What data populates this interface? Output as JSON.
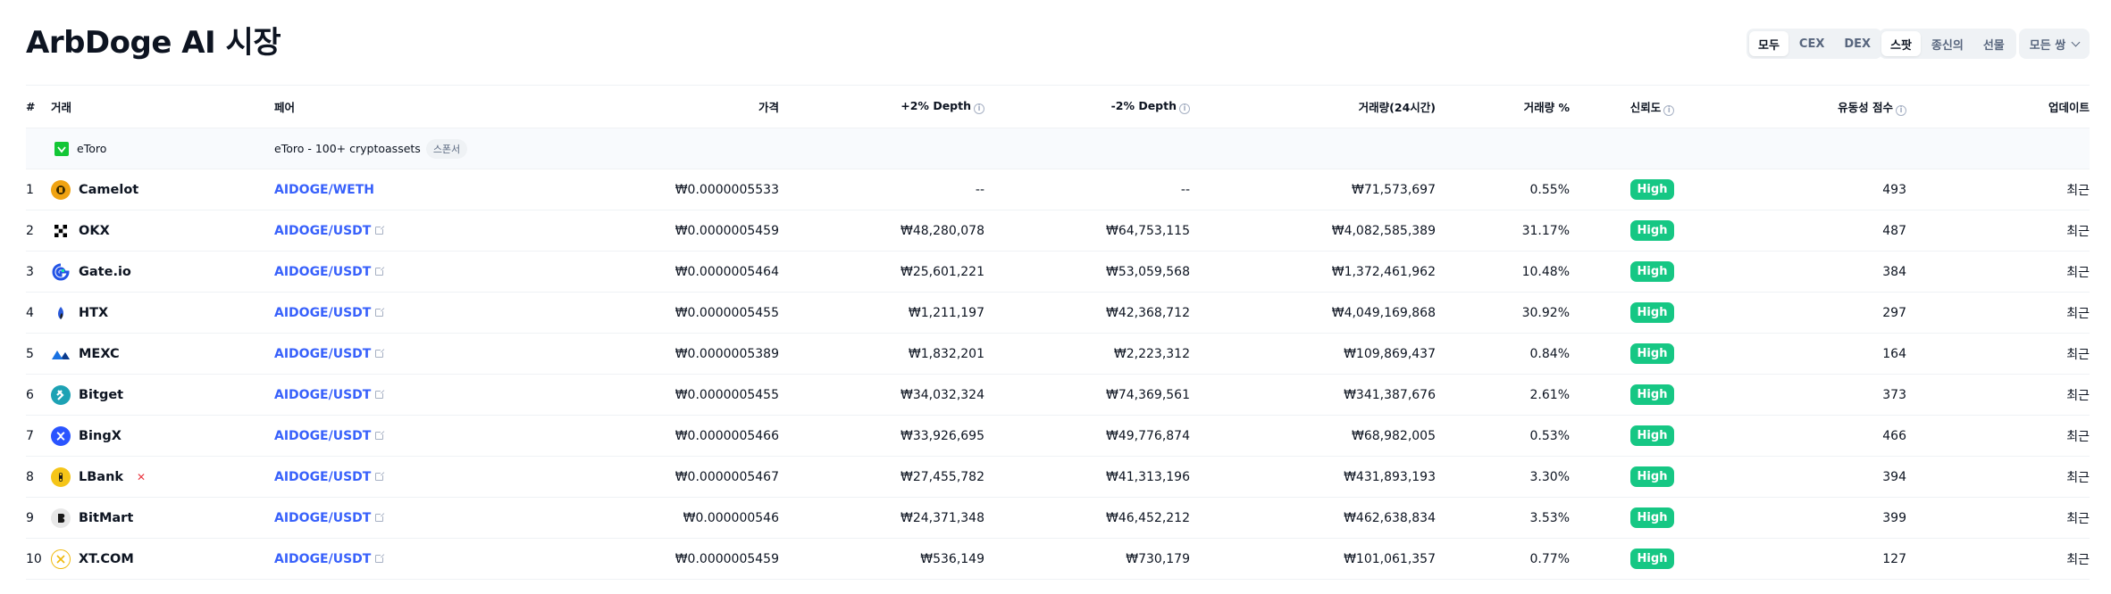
{
  "header": {
    "title": "ArbDoge AI 시장"
  },
  "filters": {
    "exchange_type": [
      "모두",
      "CEX",
      "DEX"
    ],
    "market_type": [
      "스팟",
      "종신의",
      "선물"
    ],
    "pairs_dropdown": "모든 쌍"
  },
  "columns": {
    "rank": "#",
    "exchange": "거래",
    "pair": "페어",
    "price": "가격",
    "depth_plus": "+2% Depth",
    "depth_minus": "-2% Depth",
    "volume": "거래량(24시간)",
    "volume_pct": "거래량 %",
    "confidence": "신뢰도",
    "liquidity": "유동성 점수",
    "updated": "업데이트"
  },
  "sponsor": {
    "name": "eToro",
    "text": "eToro - 100+ cryptoassets",
    "badge": "스폰서"
  },
  "rows": [
    {
      "rank": "1",
      "exchange": "Camelot",
      "pair": "AIDOGE/WETH",
      "price": "₩0.0000005533",
      "depth_plus": "--",
      "depth_minus": "--",
      "volume": "₩71,573,697",
      "volume_pct": "0.55%",
      "confidence": "High",
      "liquidity": "493",
      "updated": "최근"
    },
    {
      "rank": "2",
      "exchange": "OKX",
      "pair": "AIDOGE/USDT",
      "price": "₩0.0000005459",
      "depth_plus": "₩48,280,078",
      "depth_minus": "₩64,753,115",
      "volume": "₩4,082,585,389",
      "volume_pct": "31.17%",
      "confidence": "High",
      "liquidity": "487",
      "updated": "최근"
    },
    {
      "rank": "3",
      "exchange": "Gate.io",
      "pair": "AIDOGE/USDT",
      "price": "₩0.0000005464",
      "depth_plus": "₩25,601,221",
      "depth_minus": "₩53,059,568",
      "volume": "₩1,372,461,962",
      "volume_pct": "10.48%",
      "confidence": "High",
      "liquidity": "384",
      "updated": "최근"
    },
    {
      "rank": "4",
      "exchange": "HTX",
      "pair": "AIDOGE/USDT",
      "price": "₩0.0000005455",
      "depth_plus": "₩1,211,197",
      "depth_minus": "₩42,368,712",
      "volume": "₩4,049,169,868",
      "volume_pct": "30.92%",
      "confidence": "High",
      "liquidity": "297",
      "updated": "최근"
    },
    {
      "rank": "5",
      "exchange": "MEXC",
      "pair": "AIDOGE/USDT",
      "price": "₩0.0000005389",
      "depth_plus": "₩1,832,201",
      "depth_minus": "₩2,223,312",
      "volume": "₩109,869,437",
      "volume_pct": "0.84%",
      "confidence": "High",
      "liquidity": "164",
      "updated": "최근"
    },
    {
      "rank": "6",
      "exchange": "Bitget",
      "pair": "AIDOGE/USDT",
      "price": "₩0.0000005455",
      "depth_plus": "₩34,032,324",
      "depth_minus": "₩74,369,561",
      "volume": "₩341,387,676",
      "volume_pct": "2.61%",
      "confidence": "High",
      "liquidity": "373",
      "updated": "최근"
    },
    {
      "rank": "7",
      "exchange": "BingX",
      "pair": "AIDOGE/USDT",
      "price": "₩0.0000005466",
      "depth_plus": "₩33,926,695",
      "depth_minus": "₩49,776,874",
      "volume": "₩68,982,005",
      "volume_pct": "0.53%",
      "confidence": "High",
      "liquidity": "466",
      "updated": "최근"
    },
    {
      "rank": "8",
      "exchange": "LBank",
      "pair": "AIDOGE/USDT",
      "price": "₩0.0000005467",
      "depth_plus": "₩27,455,782",
      "depth_minus": "₩41,313,196",
      "volume": "₩431,893,193",
      "volume_pct": "3.30%",
      "confidence": "High",
      "liquidity": "394",
      "updated": "최근"
    },
    {
      "rank": "9",
      "exchange": "BitMart",
      "pair": "AIDOGE/USDT",
      "price": "₩0.000000546",
      "depth_plus": "₩24,371,348",
      "depth_minus": "₩46,452,212",
      "volume": "₩462,638,834",
      "volume_pct": "3.53%",
      "confidence": "High",
      "liquidity": "399",
      "updated": "최근"
    },
    {
      "rank": "10",
      "exchange": "XT.COM",
      "pair": "AIDOGE/USDT",
      "price": "₩0.0000005459",
      "depth_plus": "₩536,149",
      "depth_minus": "₩730,179",
      "volume": "₩101,061,357",
      "volume_pct": "0.77%",
      "confidence": "High",
      "liquidity": "127",
      "updated": "최근"
    }
  ],
  "colors": {
    "accent": "#3861fb",
    "high_badge": "#16c784",
    "text": "#0d1421",
    "muted": "#58667e"
  },
  "icons": [
    "info-icon",
    "external-link-icon",
    "chevron-down-icon",
    "warning-icon"
  ]
}
